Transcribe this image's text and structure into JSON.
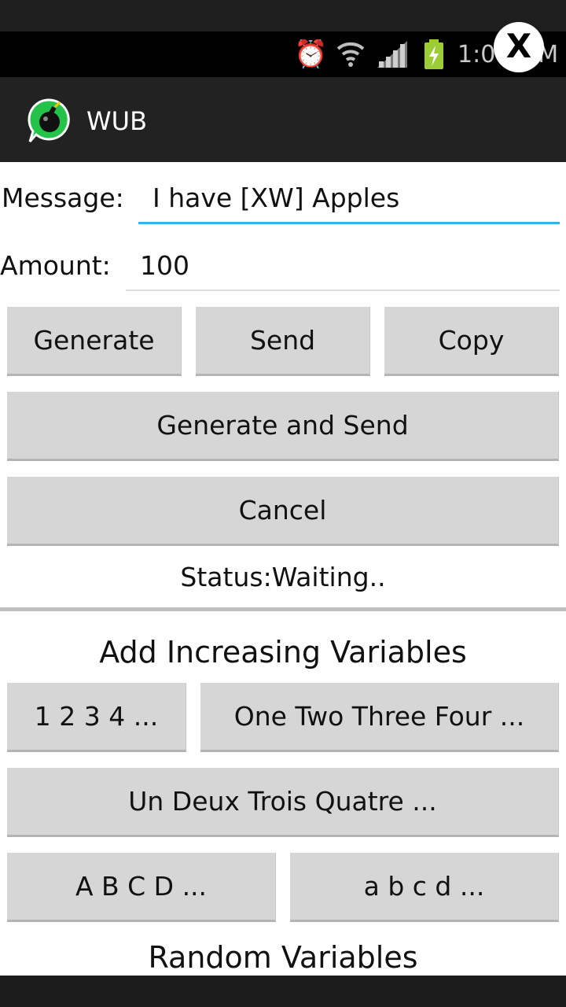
{
  "statusbar": {
    "time": "1:0",
    "time_suffix": "M",
    "icons": [
      "alarm-icon",
      "wifi-icon",
      "signal-icon",
      "battery-charging-icon"
    ]
  },
  "overlay": {
    "close_label": "X"
  },
  "actionbar": {
    "title": "WUB",
    "icon": "app-bomb-chat-icon"
  },
  "form": {
    "message_label": "Message:",
    "message_value": "I have [XW] Apples",
    "amount_label": "Amount:",
    "amount_value": "100"
  },
  "buttons": {
    "generate": "Generate",
    "send": "Send",
    "copy": "Copy",
    "generate_and_send": "Generate and Send",
    "cancel": "Cancel"
  },
  "status_text": "Status:Waiting..",
  "increasing": {
    "heading": "Add Increasing Variables",
    "numbers": "1 2 3 4 ...",
    "words": "One Two Three Four ...",
    "french": "Un Deux Trois Quatre ...",
    "upper": "A B C D ...",
    "lower": "a b c d ..."
  },
  "random": {
    "heading": "Random Variables"
  },
  "colors": {
    "accent": "#33b5e5",
    "button": "#d6d6d6",
    "actionbar": "#222222"
  }
}
